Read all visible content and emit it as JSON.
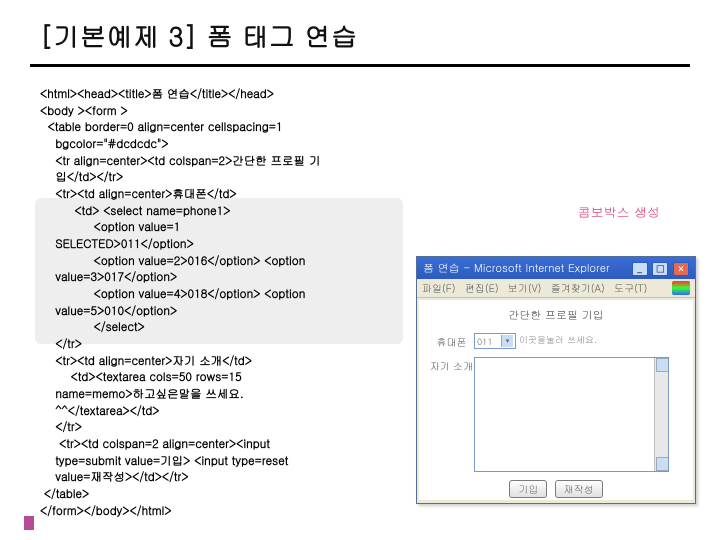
{
  "title": "[기본예제 3] 폼 태그 연습",
  "annotation": "콤보박스 생성",
  "code": "<html><head><title>폼 연습</title></head>\n<body ><form >\n  <table border=0 align=center cellspacing=1\n    bgcolor=\"#dcdcdc\">\n    <tr align=center><td colspan=2>간단한 프로필 기\n    입</td></tr>\n    <tr><td align=center>휴대폰</td>\n         <td> <select name=phone1>\n              <option value=1\n    SELECTED>011</option>\n              <option value=2>016</option> <option\n    value=3>017</option>\n              <option value=4>018</option> <option\n    value=5>010</option>\n              </select>\n    </tr>\n    <tr><td align=center>자기 소개</td>\n        <td><textarea cols=50 rows=15\n    name=memo>하고싶은말을 쓰세요.\n    ^^</textarea></td>\n    </tr>\n     <tr><td colspan=2 align=center><input\n    type=submit value=기입> <input type=reset\n    value=재작성></td></tr>\n </table>\n</form></body></html>",
  "browser": {
    "title": "폼 연습 - Microsoft Internet Explorer",
    "menu": [
      "파일(F)",
      "편집(E)",
      "보기(V)",
      "즐겨찾기(A)",
      "도구(T)"
    ],
    "profile_title": "간단한 프로필 기입",
    "label_phone": "휴대폰",
    "phone_selected": "011",
    "phone_hint": "이곳을눌러 쓰세요.",
    "label_intro": "자기 소개",
    "textarea_placeholder": "",
    "btn_submit": "기입",
    "btn_reset": "재작성"
  }
}
